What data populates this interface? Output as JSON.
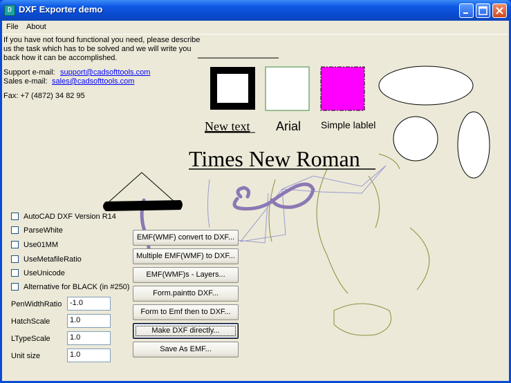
{
  "window": {
    "title": "DXF Exporter demo"
  },
  "menu": {
    "file": "File",
    "about": "About"
  },
  "info": {
    "line1": "If you have not found functional you need, please describe",
    "line2": "us the task which has to be solved and we will write you",
    "line3": "back how it can be accomplished.",
    "support_label": "Support e-mail:",
    "support_email": "support@cadsofttools.com",
    "sales_label": "Sales e-mail:",
    "sales_email": "sales@cadsofttools.com",
    "fax": "Fax: +7 (4872) 34 82 95"
  },
  "canvas": {
    "new_text": "New text",
    "arial": "Arial",
    "simple_label": "Simple lablel",
    "times": "Times New Roman",
    "colors": {
      "magenta": "#ff00ff",
      "green_border": "#3a8a3a",
      "purple_stroke": "#8c78b4",
      "olive_stroke": "#8c8c3a",
      "lavender_stroke": "#9a9ad0"
    }
  },
  "options": {
    "cb_r14": "AutoCAD DXF Version R14",
    "cb_parsewhite": "ParseWhite",
    "cb_use01mm": "Use01MM",
    "cb_metafile": "UseMetafileRatio",
    "cb_unicode": "UseUnicode",
    "cb_black": "Alternative for BLACK (in #250)"
  },
  "fields": {
    "penwidth": {
      "label": "PenWidthRatio",
      "value": "-1.0"
    },
    "hatch": {
      "label": "HatchScale",
      "value": "1.0"
    },
    "ltype": {
      "label": "LTypeScale",
      "value": "1.0"
    },
    "unit": {
      "label": "Unit size",
      "value": "1.0"
    }
  },
  "buttons": {
    "emf_convert": "EMF(WMF) convert to DXF...",
    "multiple": "Multiple EMF(WMF) to DXF...",
    "layers": "EMF(WMF)s - Layers...",
    "paintto": "Form.paintto DXF...",
    "form_emf": "Form to Emf then to DXF...",
    "make_dxf": "Make DXF directly...",
    "save_emf": "Save As EMF..."
  }
}
